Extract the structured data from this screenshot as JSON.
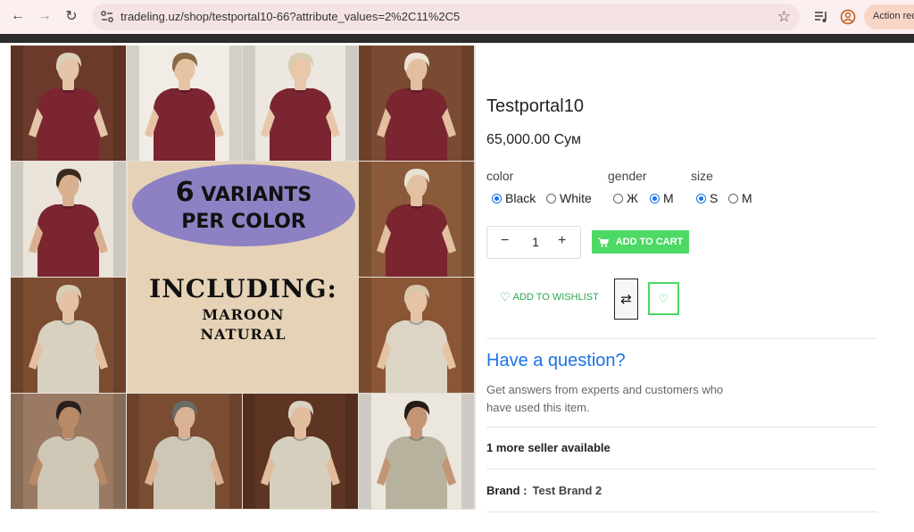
{
  "browser": {
    "url": "tradeling.uz/shop/testportal10-66?attribute_values=2%2C11%2C5",
    "action_pill": "Action req"
  },
  "gallery": {
    "promo": {
      "variants_num": "6",
      "variants_word": "VARIANTS",
      "per_color": "PER COLOR",
      "including": "INCLUDING:",
      "color1": "MAROON",
      "color2": "NATURAL"
    },
    "tiles": [
      {
        "shirt": "#7a2530",
        "bg": "#6b3a2a",
        "hair": "#d9cfb8",
        "skin": "#e5c4a8"
      },
      {
        "shirt": "#7a2530",
        "bg": "#f1ece5",
        "hair": "#8a6a45",
        "skin": "#e6c3a5"
      },
      {
        "shirt": "#7a2530",
        "bg": "#ece7e0",
        "hair": "#d8cdb0",
        "skin": "#e8c7aa"
      },
      {
        "shirt": "#7a2530",
        "bg": "#7a4a32",
        "hair": "#ebe4d4",
        "skin": "#e3bfa0"
      },
      {
        "shirt": "#7a2530",
        "bg": "#e9e3da",
        "hair": "#3b2a20",
        "skin": "#d9b08f"
      },
      {
        "shirt": "#7a2530",
        "bg": "#8a5a3a",
        "hair": "#e8e1d1",
        "skin": "#e3c0a2"
      },
      {
        "shirt": "#d8d1c2",
        "bg": "#7b4c30",
        "hair": "#d6ccb6",
        "skin": "#e4c1a3"
      },
      {
        "shirt": "#dcd5c6",
        "bg": "#8a5636",
        "hair": "#d4c7aa",
        "skin": "#e5c3a4"
      },
      {
        "shirt": "#cfc7b6",
        "bg": "#9a7a62",
        "hair": "#2a1f1a",
        "skin": "#b98a68"
      },
      {
        "shirt": "#cfc7b6",
        "bg": "#7a4c32",
        "hair": "#6a6a66",
        "skin": "#d9b294"
      },
      {
        "shirt": "#d6cfbf",
        "bg": "#5d3522",
        "hair": "#d8d1c4",
        "skin": "#e1bd9e"
      },
      {
        "shirt": "#b7b29e",
        "bg": "#ebe6de",
        "hair": "#241a14",
        "skin": "#c49574"
      }
    ]
  },
  "product": {
    "title": "Testportal10",
    "price": "65,000.00 Сум",
    "attributes": {
      "color": {
        "label": "color",
        "options": [
          "Black",
          "White"
        ],
        "selected": "Black"
      },
      "gender": {
        "label": "gender",
        "options": [
          "Ж",
          "M"
        ],
        "selected": "M"
      },
      "size": {
        "label": "size",
        "options": [
          "S",
          "M"
        ],
        "selected": "S"
      }
    },
    "quantity": "1",
    "minus": "−",
    "plus": "+",
    "add_to_cart": "ADD TO CART",
    "add_to_wishlist": "ADD TO WISHLIST",
    "question_title": "Have a question?",
    "question_text": "Get answers from experts and customers who have used this item.",
    "sellers": "1 more seller available",
    "brand_label": "Brand :",
    "brand_value": "Test Brand 2"
  },
  "colors": {
    "accent_green": "#4cd964",
    "link_blue": "#1a73e8",
    "wishlist_green": "#2aa84a"
  }
}
